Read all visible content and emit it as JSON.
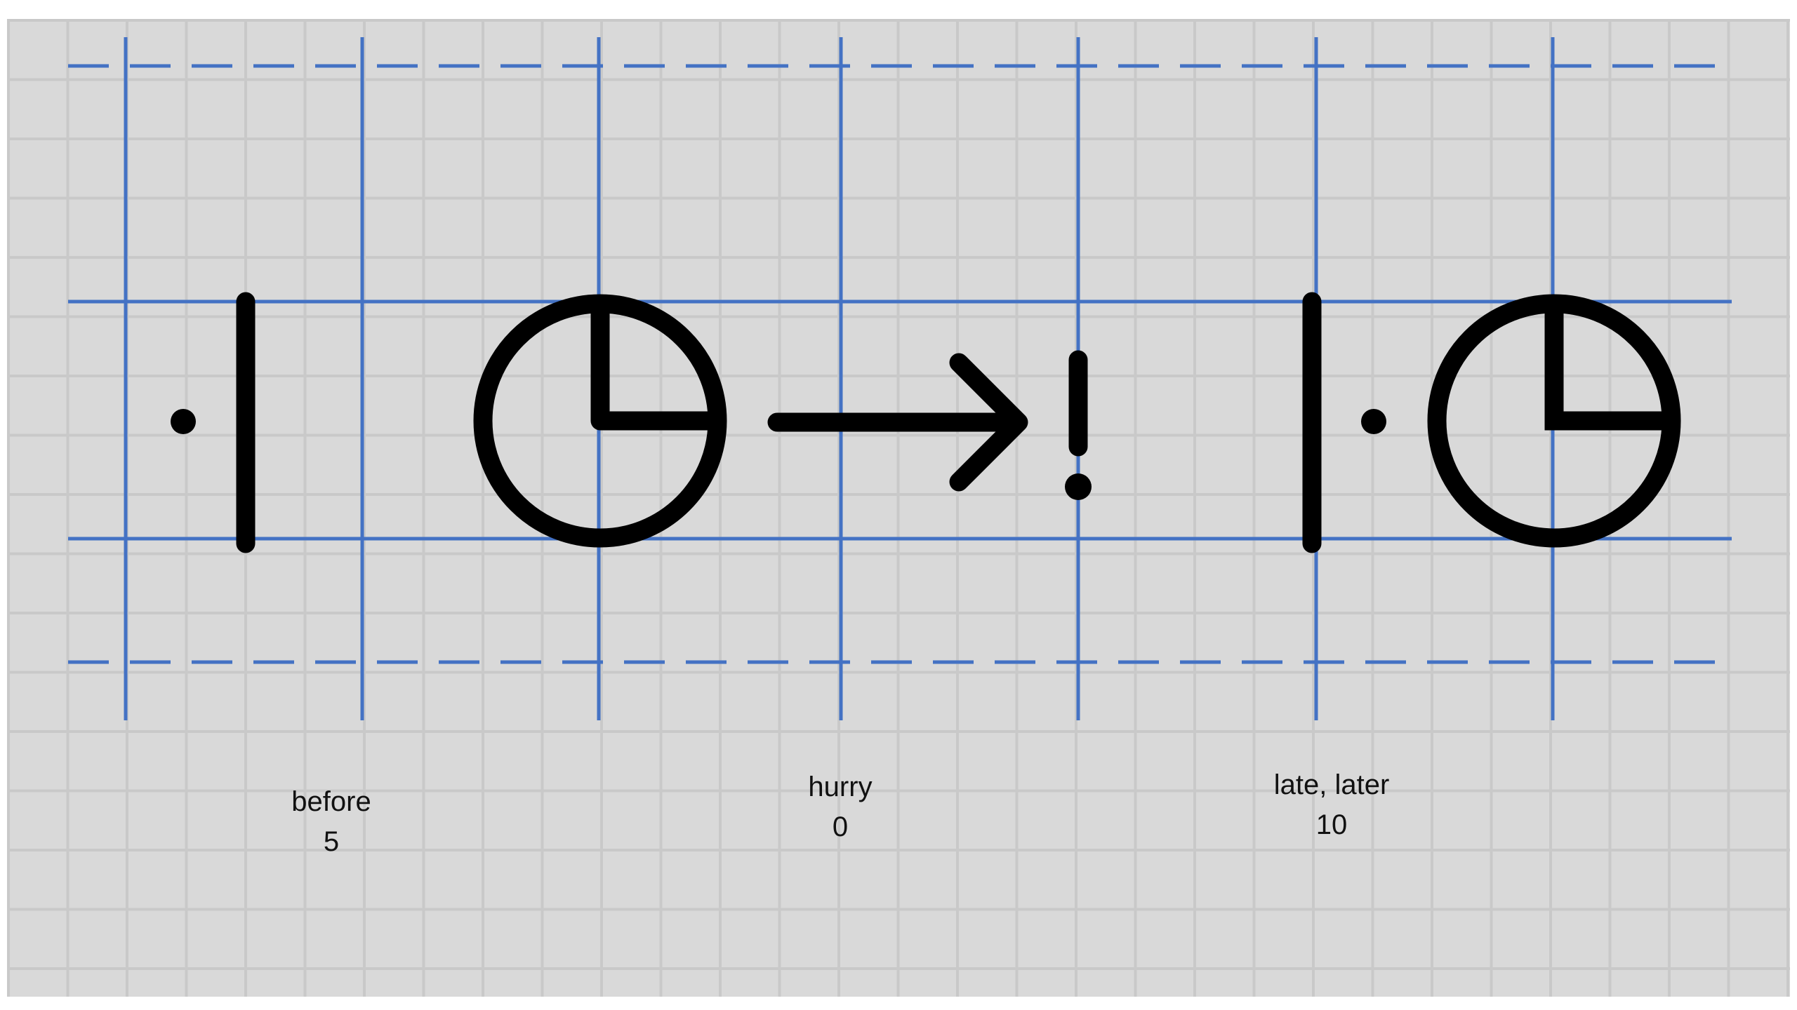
{
  "colors": {
    "background": "#d9d9d9",
    "grid_fine": "#c9c9c9",
    "guide_lines": "#4472c4",
    "glyph_stroke": "#000000",
    "label_text": "#111111"
  },
  "glyphs": [
    {
      "name": "before",
      "parts": [
        "dot",
        "vertical-bar"
      ],
      "word": "before",
      "number": "5"
    },
    {
      "name": "hurry",
      "parts": [
        "clock",
        "right-arrow",
        "exclamation"
      ],
      "word": "hurry",
      "number": "0"
    },
    {
      "name": "late-later",
      "parts": [
        "vertical-bar",
        "dot",
        "clock"
      ],
      "word": "late, later",
      "number": "10"
    }
  ]
}
